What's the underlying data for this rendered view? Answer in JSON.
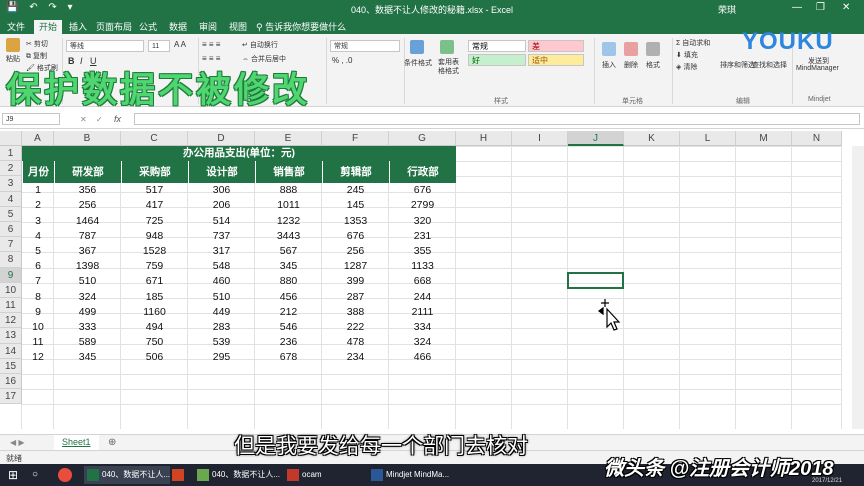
{
  "window": {
    "title": "040、数据不让人修改的秘籍.xlsx - Excel",
    "user": "荣琪",
    "min": "—",
    "restore": "❐",
    "close": "✕",
    "qat": "💾 ↶ ↷ ▾"
  },
  "ribbon": {
    "tabs": [
      "文件",
      "开始",
      "插入",
      "页面布局",
      "公式",
      "数据",
      "审阅",
      "视图"
    ],
    "active_tab": "开始",
    "tell_me": "告诉我你想要做什么",
    "clipboard": {
      "cut": "剪切",
      "copy": "复制",
      "format_painter": "格式刷",
      "paste": "粘贴"
    },
    "font": {
      "name": "等线",
      "size": "11"
    },
    "alignment": {
      "wrap": "自动换行",
      "merge": "合并后居中"
    },
    "number": {
      "format": "常规"
    },
    "styles": {
      "conditional": "条件格式",
      "as_table": "套用表格格式",
      "normal": "常规",
      "bad": "差",
      "good": "好",
      "neutral": "适中",
      "group": "样式"
    },
    "cells": {
      "insert": "插入",
      "delete": "删除",
      "format": "格式",
      "group": "单元格"
    },
    "editing": {
      "autosum": "自动求和",
      "fill": "填充",
      "clear": "清除",
      "sort": "排序和筛选",
      "find": "查找和选择",
      "group": "编辑"
    },
    "mindjet": {
      "send": "发送到",
      "app": "MindManager",
      "group": "Mindjet"
    }
  },
  "overlay_title": "保护数据不被修改",
  "watermark_logo": "YOUKU",
  "formula_bar": {
    "name_box": "J9",
    "cancel": "✕",
    "enter": "✓",
    "fx": "fx",
    "value": ""
  },
  "sheet": {
    "columns": [
      "A",
      "B",
      "C",
      "D",
      "E",
      "F",
      "G",
      "H",
      "I",
      "J",
      "K",
      "L",
      "M",
      "N"
    ],
    "row_numbers": [
      "1",
      "2",
      "3",
      "4",
      "5",
      "6",
      "7",
      "8",
      "9",
      "10",
      "11",
      "12",
      "13",
      "14",
      "15",
      "16",
      "17"
    ],
    "selected_cell": "J9",
    "table_title": "办公用品支出(单位：元)",
    "headers": [
      "月份",
      "研发部",
      "采购部",
      "设计部",
      "销售部",
      "剪辑部",
      "行政部"
    ],
    "rows": [
      [
        "1",
        "356",
        "517",
        "306",
        "888",
        "245",
        "676"
      ],
      [
        "2",
        "256",
        "417",
        "206",
        "1011",
        "145",
        "2799"
      ],
      [
        "3",
        "1464",
        "725",
        "514",
        "1232",
        "1353",
        "320"
      ],
      [
        "4",
        "787",
        "948",
        "737",
        "3443",
        "676",
        "231"
      ],
      [
        "5",
        "367",
        "1528",
        "317",
        "567",
        "256",
        "355"
      ],
      [
        "6",
        "1398",
        "759",
        "548",
        "345",
        "1287",
        "1133"
      ],
      [
        "7",
        "510",
        "671",
        "460",
        "880",
        "399",
        "668"
      ],
      [
        "8",
        "324",
        "185",
        "510",
        "456",
        "287",
        "244"
      ],
      [
        "9",
        "499",
        "1160",
        "449",
        "212",
        "388",
        "2111"
      ],
      [
        "10",
        "333",
        "494",
        "283",
        "546",
        "222",
        "334"
      ],
      [
        "11",
        "589",
        "750",
        "539",
        "236",
        "478",
        "324"
      ],
      [
        "12",
        "345",
        "506",
        "295",
        "678",
        "234",
        "466"
      ]
    ]
  },
  "sheet_tabs": [
    "Sheet1"
  ],
  "add_sheet": "⊕",
  "status": {
    "ready": "就绪"
  },
  "subtitle": "但是我要发给每一个部门去核对",
  "taskbar": {
    "items": [
      "040、数据不让人...",
      "",
      "040、数据不让人...",
      "ocam",
      "Mindjet MindMa..."
    ],
    "date": "2017/12/21"
  },
  "credit": "微头条 @注册会计师2018"
}
